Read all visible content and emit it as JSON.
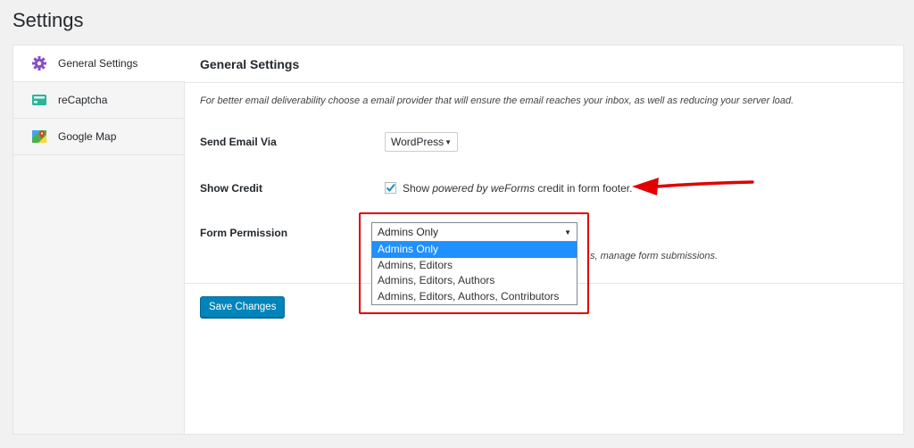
{
  "page": {
    "title": "Settings"
  },
  "sidebar": {
    "items": [
      {
        "label": "General Settings",
        "icon": "gear-icon",
        "active": true
      },
      {
        "label": "reCaptcha",
        "icon": "recaptcha-icon"
      },
      {
        "label": "Google Map",
        "icon": "map-icon"
      }
    ]
  },
  "main": {
    "header": "General Settings",
    "description": "For better email deliverability choose a email provider that will ensure the email reaches your inbox, as well as reducing your server load.",
    "send_email": {
      "label": "Send Email Via",
      "value": "WordPress"
    },
    "show_credit": {
      "label": "Show Credit",
      "checked": true,
      "text_prefix": "Show ",
      "text_emph": "powered by weForms",
      "text_suffix": " credit in form footer."
    },
    "form_permission": {
      "label": "Form Permission",
      "value": "Admins Only",
      "options": [
        "Admins Only",
        "Admins, Editors",
        "Admins, Editors, Authors",
        "Admins, Editors, Authors, Contributors"
      ],
      "help_fragment": "s, manage form submissions."
    },
    "save_label": "Save Changes"
  },
  "colors": {
    "accent": "#0085ba",
    "highlight": "#e00000",
    "selected": "#1e90ff"
  }
}
